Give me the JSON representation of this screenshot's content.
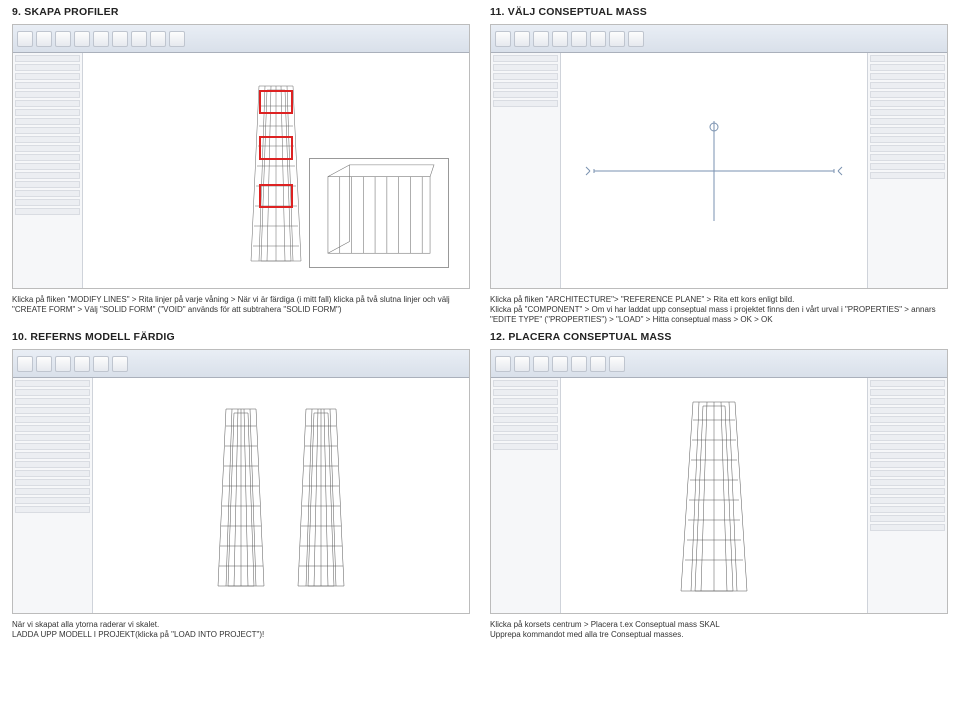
{
  "sections": {
    "s9": {
      "title": "9. SKAPA PROFILER"
    },
    "s10": {
      "title": "10. REFERNS MODELL FÄRDIG"
    },
    "s11": {
      "title": "11. VÄLJ CONSEPTUAL MASS"
    },
    "s12": {
      "title": "12. PLACERA CONSEPTUAL MASS"
    }
  },
  "captions": {
    "c9a": "Klicka på fliken \"MODIFY LINES\" > Rita linjer på varje våning > När vi är färdiga (i mitt fall) klicka på två slutna linjer och välj \"CREATE FORM\" > Välj \"SOLID FORM\" (\"VOID\" används för att subtrahera \"SOLID FORM\")",
    "c11a": "Klicka på fliken \"ARCHITECTURE\"> \"REFERENCE PLANE\" > Rita ett kors enligt bild.",
    "c11b": "Klicka på \"COMPONENT\" > Om vi har laddat upp conseptual mass i projektet finns den i vårt urval i \"PROPERTIES\" > annars \"EDITE TYPE\" (\"PROPERTIES\") > \"LOAD\" > Hitta conseptual mass > OK > OK",
    "c10a": "När vi skapat alla ytorna raderar vi skalet.",
    "c10b": "LADDA UPP MODELL I PROJEKT(klicka på \"LOAD INTO PROJECT\")!",
    "c12a": "Klicka på korsets centrum > Placera t.ex Conseptual mass SKAL",
    "c12b": "Upprepa kommandot med alla tre Conseptual masses."
  }
}
